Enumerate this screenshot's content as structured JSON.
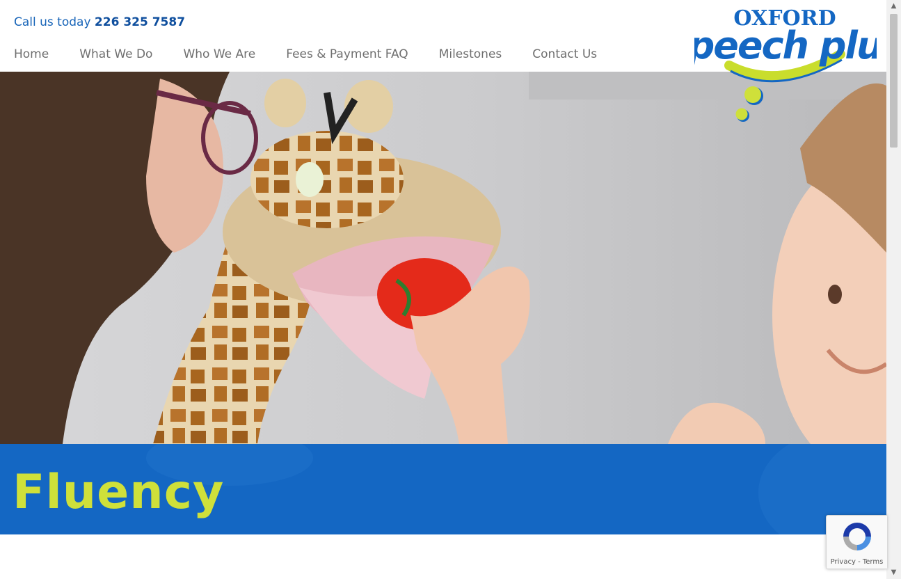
{
  "header": {
    "phone_prefix": "Call us today",
    "phone_number": "226 325 7587"
  },
  "nav": {
    "items": [
      "Home",
      "What We Do",
      "Who We Are",
      "Fees & Payment FAQ",
      "Milestones",
      "Contact Us"
    ]
  },
  "logo": {
    "line1": "OXFORD",
    "line2": "speech plus"
  },
  "hero": {
    "title": "Fluency"
  },
  "recaptcha": {
    "privacy": "Privacy",
    "separator": " - ",
    "terms": "Terms"
  },
  "colors": {
    "brand_blue": "#1467c3",
    "brand_lime": "#cfe03a",
    "phone_blue": "#1764b8",
    "nav_gray": "#6f6f6f"
  }
}
